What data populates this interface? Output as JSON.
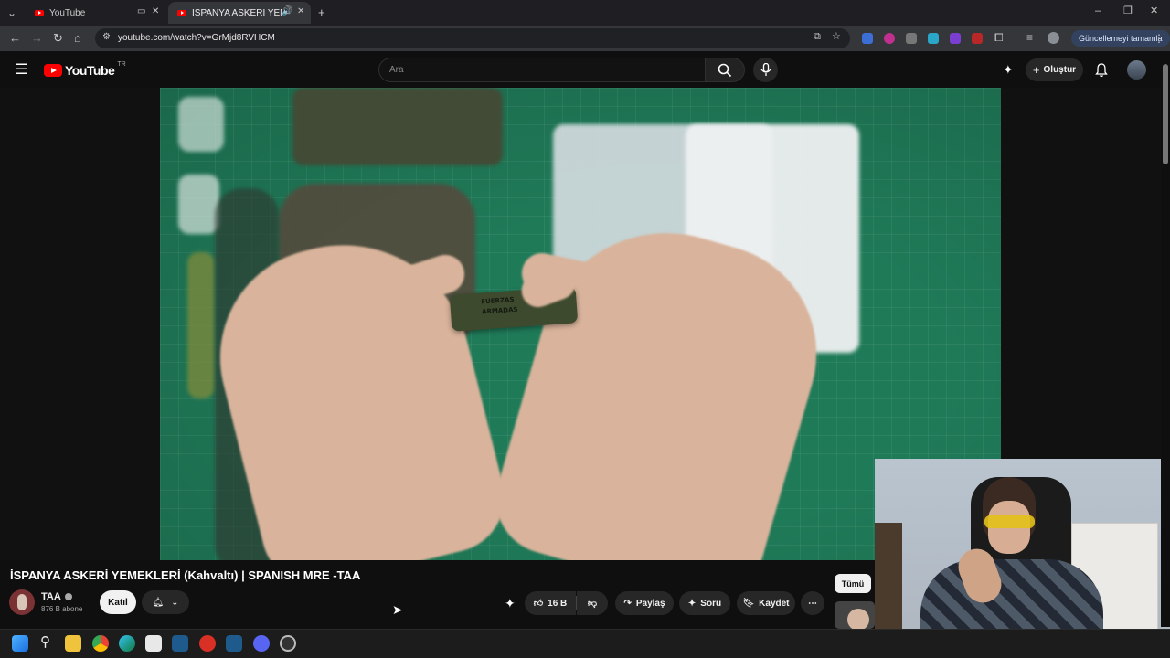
{
  "browser": {
    "tabs": [
      {
        "title": "YouTube"
      },
      {
        "title": "İSPANYA ASKERİ YEMEKLER"
      }
    ],
    "url": "youtube.com/watch?v=GrMjd8RVHCM",
    "update_label": "Güncellemeyi tamamla"
  },
  "youtube": {
    "logo": "YouTube",
    "region": "TR",
    "search_placeholder": "Ara",
    "create_label": "Oluştur"
  },
  "video": {
    "title": "İSPANYA ASKERİ YEMEKLERİ (Kahvaltı) | SPANISH MRE -TAA",
    "channel": "TAA",
    "subscribers": "876 B abone",
    "join_label": "Katıl",
    "likes": "16 B",
    "share_label": "Paylaş",
    "ask_label": "Soru",
    "save_label": "Kaydet",
    "package_text_1": "FUERZAS",
    "package_text_2": "ARMADAS"
  },
  "sidebar": {
    "filter_all": "Tümü"
  },
  "colors": {
    "brand_red": "#ff0000",
    "background": "#0f0f0f",
    "cutting_mat": "#1f7a58"
  }
}
